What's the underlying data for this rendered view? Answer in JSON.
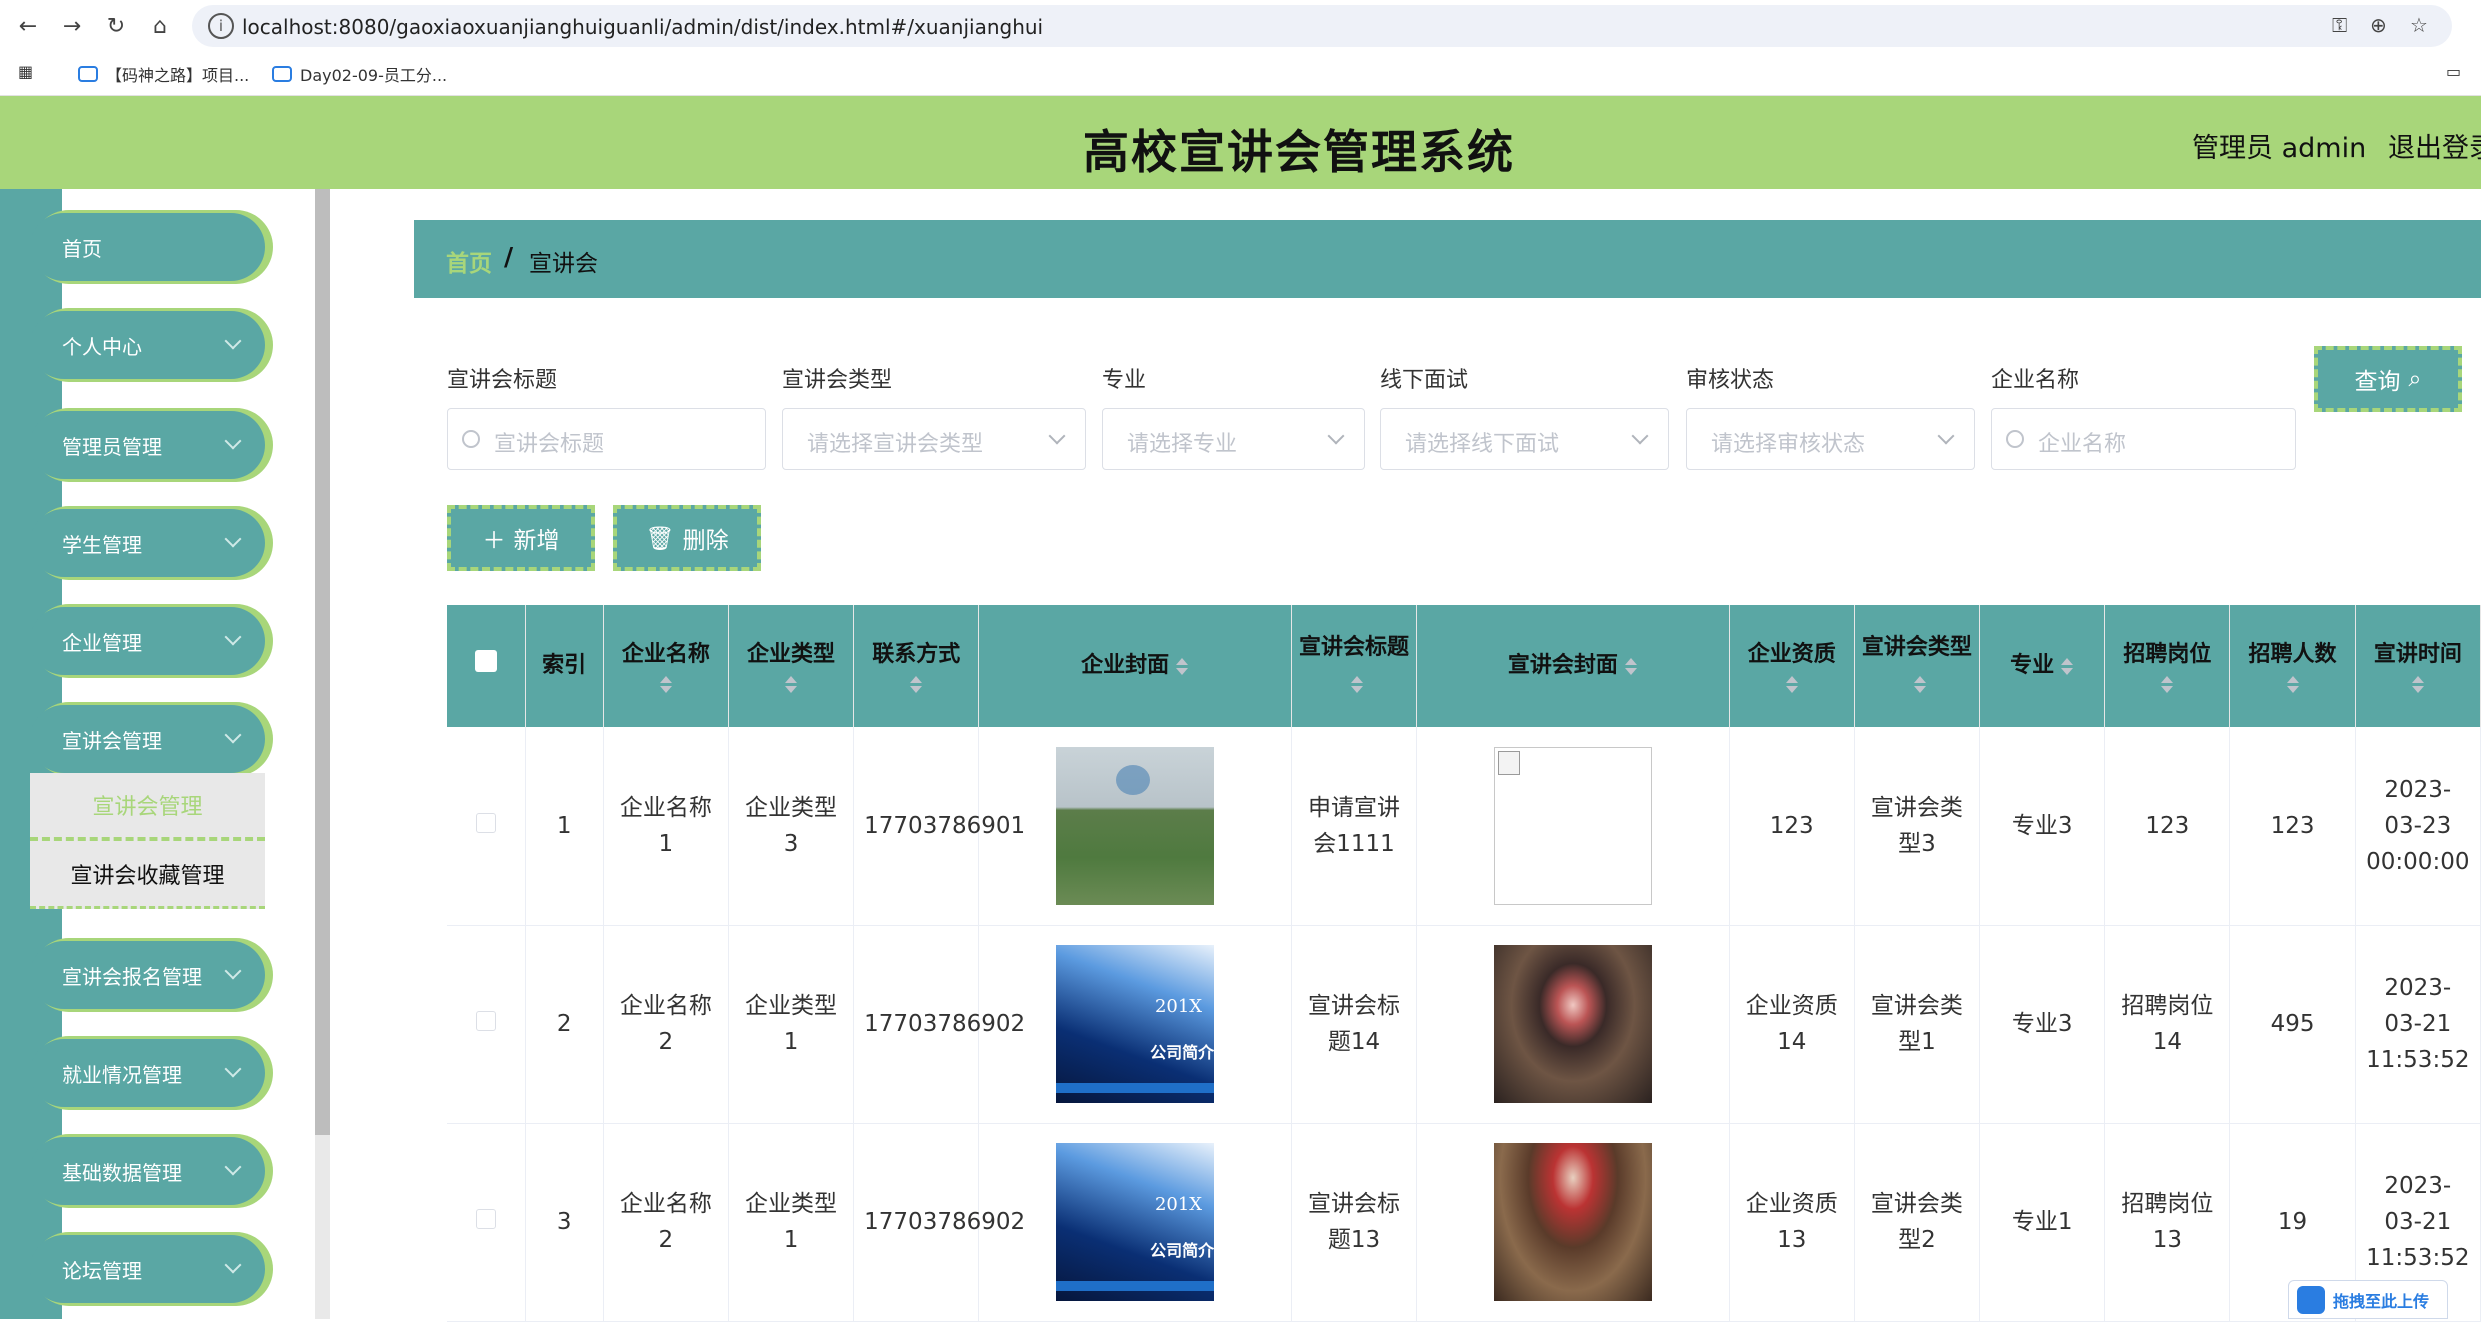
{
  "browser": {
    "url": "localhost:8080/gaoxiaoxuanjianghuiguanli/admin/dist/index.html#/xuanjianghui",
    "bookmarks": [
      "【码神之路】项目...",
      "Day02-09-员工分..."
    ]
  },
  "header": {
    "title": "高校宣讲会管理系统",
    "user": "管理员 admin",
    "logout": "退出登录"
  },
  "sidebar": {
    "items": [
      {
        "label": "首页"
      },
      {
        "label": "个人中心"
      },
      {
        "label": "管理员管理"
      },
      {
        "label": "学生管理"
      },
      {
        "label": "企业管理"
      },
      {
        "label": "宣讲会管理"
      },
      {
        "label": "宣讲会报名管理"
      },
      {
        "label": "就业情况管理"
      },
      {
        "label": "基础数据管理"
      },
      {
        "label": "论坛管理"
      }
    ],
    "submenu": [
      "宣讲会管理",
      "宣讲会收藏管理"
    ]
  },
  "breadcrumb": {
    "home": "首页",
    "separator": "/",
    "current": "宣讲会"
  },
  "filters": {
    "labels": [
      "宣讲会标题",
      "宣讲会类型",
      "专业",
      "线下面试",
      "审核状态",
      "企业名称"
    ],
    "placeholders": [
      "宣讲会标题",
      "请选择宣讲会类型",
      "请选择专业",
      "请选择线下面试",
      "请选择审核状态",
      "企业名称"
    ],
    "query_button": "查询"
  },
  "actions": {
    "add": "新增",
    "delete": "删除"
  },
  "table": {
    "headers": [
      "索引",
      "企业名称",
      "企业类型",
      "联系方式",
      "企业封面",
      "宣讲会标题",
      "宣讲会封面",
      "企业资质",
      "宣讲会类型",
      "专业",
      "招聘岗位",
      "招聘人数",
      "宣讲时间"
    ],
    "rows": [
      {
        "index": "1",
        "company": "企业名称1",
        "type": "企业类型3",
        "phone": "17703786901",
        "title": "申请宣讲会1111",
        "qualification": "123",
        "talk_type": "宣讲会类型3",
        "major": "专业3",
        "post": "123",
        "count": "123",
        "time": "2023-03-23 00:00:00"
      },
      {
        "index": "2",
        "company": "企业名称2",
        "type": "企业类型1",
        "phone": "17703786902",
        "title": "宣讲会标题14",
        "qualification": "企业资质14",
        "talk_type": "宣讲会类型1",
        "major": "专业3",
        "post": "招聘岗位14",
        "count": "495",
        "time": "2023-03-21 11:53:52"
      },
      {
        "index": "3",
        "company": "企业名称2",
        "type": "企业类型1",
        "phone": "17703786902",
        "title": "宣讲会标题13",
        "qualification": "企业资质13",
        "talk_type": "宣讲会类型2",
        "major": "专业1",
        "post": "招聘岗位13",
        "count": "19",
        "time": "2023-03-21 11:53:52"
      }
    ],
    "cover_text": {
      "year": "201X",
      "caption": "公司简介"
    }
  },
  "upload_badge": "拖拽至此上传"
}
